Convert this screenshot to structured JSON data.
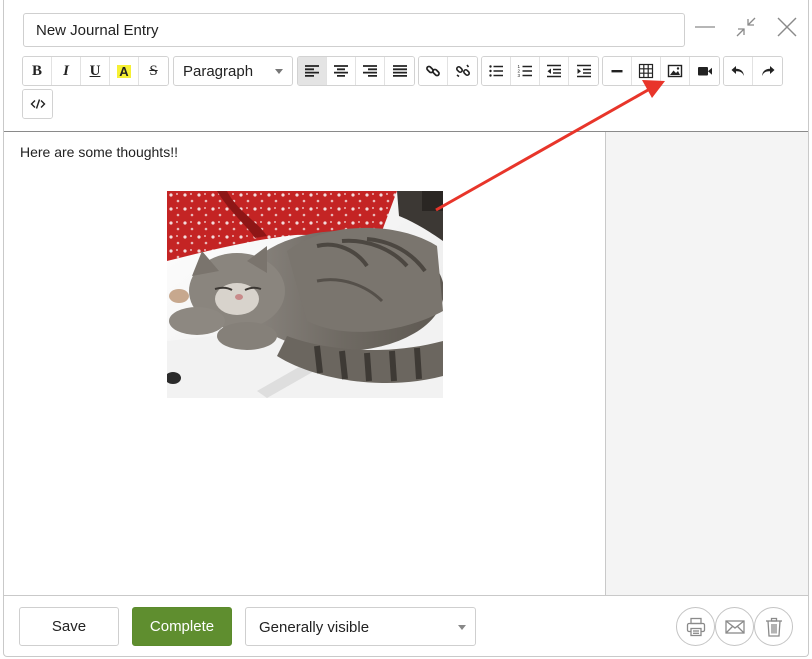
{
  "header": {
    "title_value": "New Journal Entry",
    "window_controls": [
      "minimize-icon",
      "collapse-icon",
      "close-icon"
    ]
  },
  "toolbar": {
    "text_format_buttons": [
      {
        "icon": "bold-icon",
        "label": "B"
      },
      {
        "icon": "italic-icon",
        "label": "I"
      },
      {
        "icon": "underline-icon",
        "label": "U"
      },
      {
        "icon": "highlight-icon",
        "label": "A"
      },
      {
        "icon": "strikethrough-icon",
        "label": "S"
      }
    ],
    "block_format": {
      "selected": "Paragraph"
    },
    "align_buttons": [
      "align-left-icon",
      "align-center-icon",
      "align-right-icon",
      "align-justify-icon"
    ],
    "align_active": "align-left-icon",
    "link_buttons": [
      "link-icon",
      "unlink-icon"
    ],
    "list_buttons": [
      "bullet-list-icon",
      "numbered-list-icon",
      "outdent-icon",
      "indent-icon"
    ],
    "insert_buttons": [
      "horizontal-rule-icon",
      "table-icon",
      "image-icon",
      "video-icon"
    ],
    "history_buttons": [
      "undo-icon",
      "redo-icon"
    ],
    "source_button": "code-icon"
  },
  "editor": {
    "text": "Here are some thoughts!!",
    "image": "sleeping-cat-photo"
  },
  "footer": {
    "save_label": "Save",
    "complete_label": "Complete",
    "visibility": {
      "selected": "Generally visible"
    },
    "action_icons": [
      "print-icon",
      "email-icon",
      "trash-icon"
    ]
  },
  "colors": {
    "complete_button": "#5f8e2f",
    "annotation_arrow": "#e8352a",
    "highlight_yellow": "#f6f034"
  }
}
